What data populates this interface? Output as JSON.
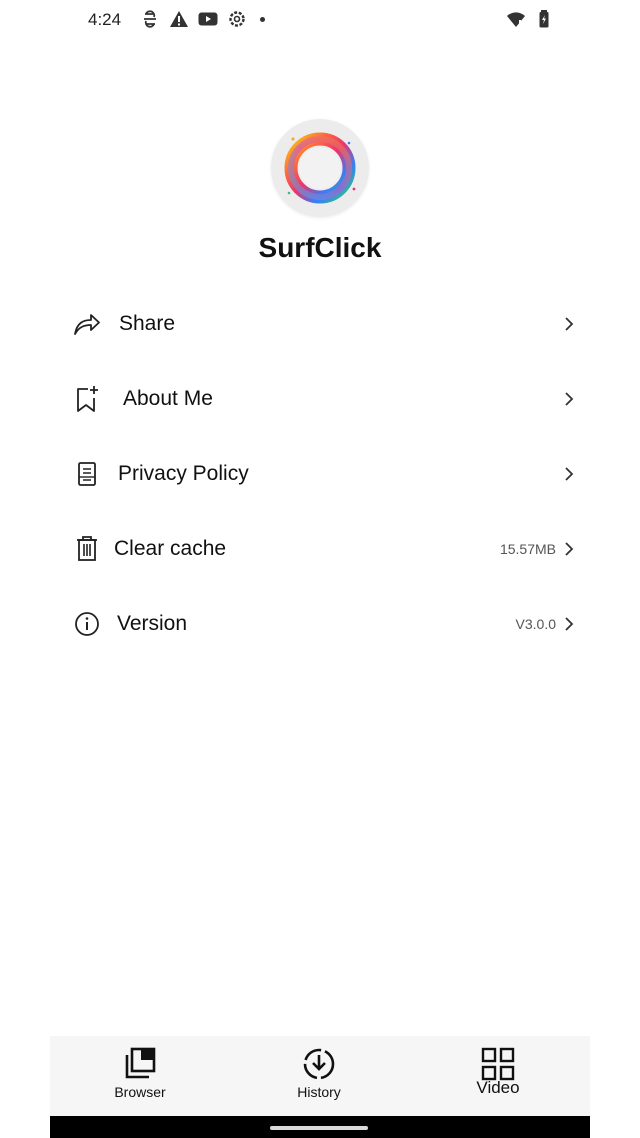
{
  "status_bar": {
    "time": "4:24",
    "left_icons": [
      "sync-icon",
      "alert-icon",
      "youtube-icon",
      "settings-icon",
      "dot-icon"
    ],
    "right_icons": [
      "wifi-icon",
      "battery-icon"
    ]
  },
  "app": {
    "name": "SurfClick",
    "logo_icon": "rainbow-ring-icon"
  },
  "menu": {
    "items": [
      {
        "label": "Share",
        "icon": "share-icon",
        "value": ""
      },
      {
        "label": "About Me",
        "icon": "bookmark-plus-icon",
        "value": ""
      },
      {
        "label": "Privacy Policy",
        "icon": "document-icon",
        "value": ""
      },
      {
        "label": "Clear cache",
        "icon": "trash-icon",
        "value": "15.57MB"
      },
      {
        "label": "Version",
        "icon": "info-icon",
        "value": "V3.0.0"
      }
    ]
  },
  "bottom_nav": {
    "items": [
      {
        "label": "Browser",
        "icon": "tabs-icon"
      },
      {
        "label": "History",
        "icon": "download-history-icon"
      },
      {
        "label": "Video",
        "icon": "grid-icon"
      }
    ]
  },
  "colors": {
    "background": "#ffffff",
    "nav_background": "#f6f6f6",
    "text": "#111111",
    "secondary_text": "#555555"
  }
}
